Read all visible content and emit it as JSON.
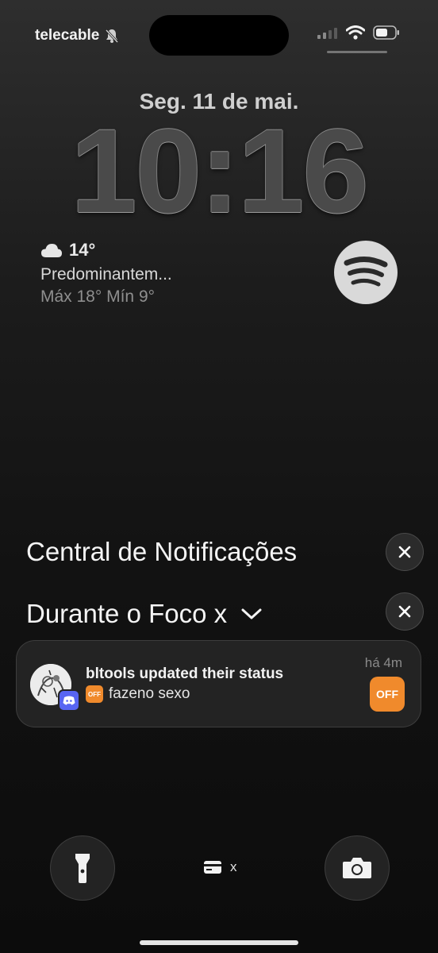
{
  "status_bar": {
    "carrier": "telecable",
    "mute_icon": "bell-slash-icon",
    "signal_icon": "cellular-signal-icon",
    "wifi_icon": "wifi-icon",
    "battery_icon": "battery-icon"
  },
  "lock_screen": {
    "date": "Seg. 11 de mai.",
    "time": "10:16"
  },
  "weather": {
    "icon": "cloud-icon",
    "temperature": "14°",
    "condition": "Predominantem...",
    "range": "Máx 18° Mín 9°"
  },
  "spotify": {
    "icon": "spotify-icon"
  },
  "notification_center": {
    "title": "Central de Notificações",
    "focus_label": "Durante o Foco x"
  },
  "notification": {
    "title": "bltools updated their status",
    "body": "fazeno sexo",
    "time": "há 4m",
    "app_icon_text": "OFF",
    "badge_icon": "discord-icon"
  },
  "bottom": {
    "flashlight_icon": "flashlight-icon",
    "camera_icon": "camera-icon",
    "wallet_label": "x"
  },
  "colors": {
    "discord": "#5865f2",
    "off_orange": "#f08a2c"
  }
}
